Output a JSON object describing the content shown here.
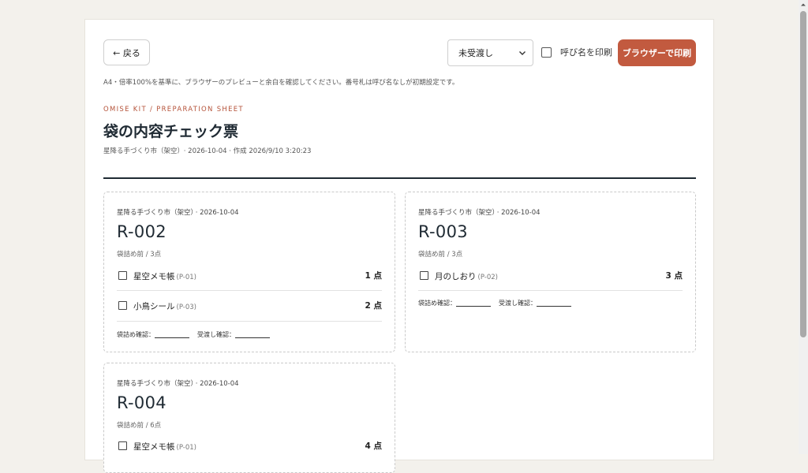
{
  "toolbar": {
    "back_label": "← 戻る",
    "select_value": "未受渡し",
    "checkbox_label": "呼び名を印刷",
    "print_label": "ブラウザーで印刷"
  },
  "note": "A4・倍率100%を基準に、ブラウザーのプレビューと余白を確認してください。番号札は呼び名なしが初期設定です。",
  "header": {
    "eyebrow": "OMISE KIT / PREPARATION SHEET",
    "title": "袋の内容チェック票",
    "meta_event": "星降る手づくり市（架空）",
    "meta_rest": "· 2026-10-04 · 作成 2026/9/10 3:20:23"
  },
  "cards": [
    {
      "event": "星降る手づくり市（架空）",
      "date": "· 2026-10-04",
      "id": "R-002",
      "sub": "袋詰め前 / 3点",
      "items": [
        {
          "name": "星空メモ帳",
          "code": "(P-01)",
          "qty": "1 点"
        },
        {
          "name": "小鳥シール",
          "code": "(P-03)",
          "qty": "2 点"
        }
      ],
      "sign_pack": "袋詰め確認：",
      "sign_hand": "受渡し確認："
    },
    {
      "event": "星降る手づくり市（架空）",
      "date": "· 2026-10-04",
      "id": "R-003",
      "sub": "袋詰め前 / 3点",
      "items": [
        {
          "name": "月のしおり",
          "code": "(P-02)",
          "qty": "3 点"
        }
      ],
      "sign_pack": "袋詰め確認：",
      "sign_hand": "受渡し確認："
    },
    {
      "event": "星降る手づくり市（架空）",
      "date": "· 2026-10-04",
      "id": "R-004",
      "sub": "袋詰め前 / 6点",
      "items": [
        {
          "name": "星空メモ帳",
          "code": "(P-01)",
          "qty": "4 点"
        }
      ]
    }
  ],
  "colors": {
    "accent": "#c25a3f",
    "text": "#1f2a33",
    "background": "#f3f1ec"
  }
}
